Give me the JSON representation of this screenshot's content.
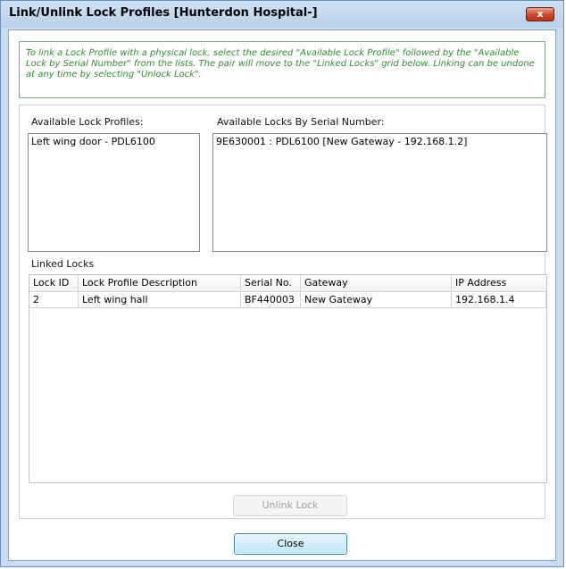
{
  "window": {
    "title": "Link/Unlink Lock Profiles [Hunterdon Hospital-]",
    "close_glyph": "x"
  },
  "info": {
    "text": "To link a Lock Profile with a physical lock, select the desired \"Available Lock Profile\" followed by the \"Available Lock by Serial Number\" from the lists. The pair will move to the \"Linked Locks\" grid below. Linking can be undone at any time by selecting \"Unlock Lock\"."
  },
  "profiles": {
    "label": "Available Lock Profiles:",
    "items": [
      "Left wing door - PDL6100"
    ]
  },
  "serials": {
    "label": "Available Locks By Serial Number:",
    "items": [
      "9E630001 : PDL6100 [New Gateway - 192.168.1.2]"
    ]
  },
  "linked": {
    "label": "Linked Locks",
    "columns": [
      "Lock ID",
      "Lock Profile Description",
      "Serial No.",
      "Gateway",
      "IP Address"
    ],
    "rows": [
      [
        "2",
        "Left wing hall",
        "BF440003",
        "New Gateway",
        "192.168.1.4"
      ]
    ]
  },
  "buttons": {
    "unlink": "Unlink Lock",
    "close": "Close"
  },
  "colors": {
    "info_text": "#2e8b2e",
    "titlebar": "#c9dcf0",
    "close_button": "#c9452c"
  }
}
